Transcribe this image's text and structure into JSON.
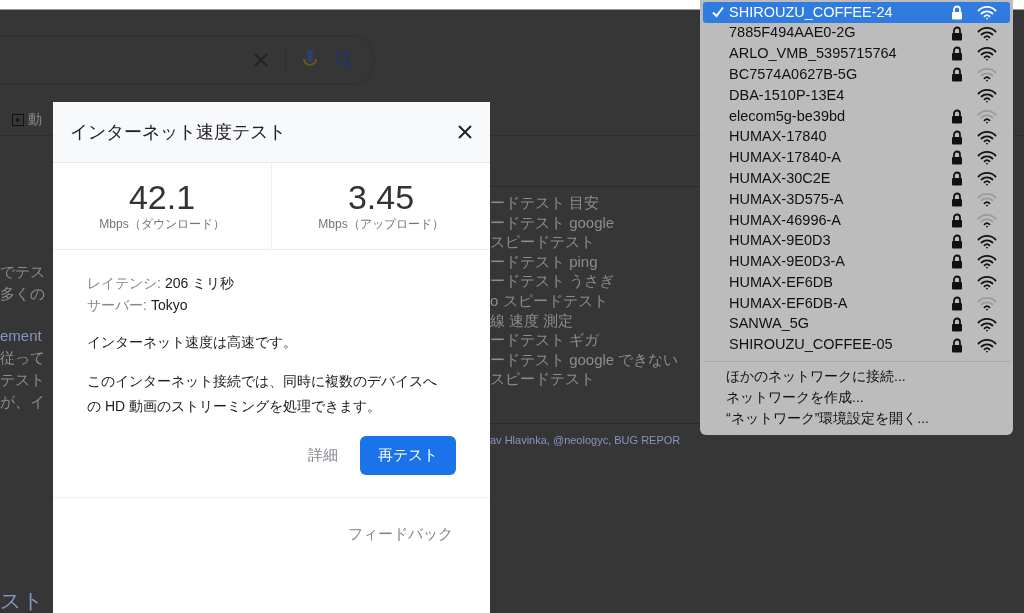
{
  "background_page": {
    "tab_fragment": "動",
    "left_fragments": [
      "でテス",
      "多くの",
      "ement",
      "従って",
      "テスト",
      "が、イ"
    ],
    "related_fragments": [
      "ードテスト 目安",
      "ードテスト google",
      "スピードテスト",
      "ードテスト ping",
      "ードテスト うさぎ",
      "o スピードテスト",
      "線 速度 測定",
      "ードテスト ギガ",
      "ードテスト google できない",
      "スピードテスト"
    ],
    "footer_fragment": "av Hlavinka, @neologyc, BUG REPOR",
    "bottom_heading_fragment": "スト"
  },
  "dialog": {
    "title": "インターネット速度テスト",
    "download": {
      "value": "42.1",
      "unit": "Mbps（ダウンロード）"
    },
    "upload": {
      "value": "3.45",
      "unit": "Mbps（アップロード）"
    },
    "latency": {
      "label": "レイテンシ:",
      "value": "206 ミリ秒"
    },
    "server": {
      "label": "サーバー:",
      "value": "Tokyo"
    },
    "verdict": "インターネット速度は高速です。",
    "description": "このインターネット接続では、同時に複数のデバイスへの HD 動画のストリーミングを処理できます。",
    "details_button": "詳細",
    "retest_button": "再テスト",
    "feedback_link": "フィードバック"
  },
  "wifi_menu": {
    "networks": [
      {
        "name": "SHIROUZU_COFFEE-24",
        "selected": true,
        "locked": true,
        "weak_signal": false
      },
      {
        "name": "7885F494AAE0-2G",
        "selected": false,
        "locked": true,
        "weak_signal": false
      },
      {
        "name": "ARLO_VMB_5395715764",
        "selected": false,
        "locked": true,
        "weak_signal": false
      },
      {
        "name": "BC7574A0627B-5G",
        "selected": false,
        "locked": true,
        "weak_signal": true
      },
      {
        "name": "DBA-1510P-13E4",
        "selected": false,
        "locked": false,
        "weak_signal": false
      },
      {
        "name": "elecom5g-be39bd",
        "selected": false,
        "locked": true,
        "weak_signal": true
      },
      {
        "name": "HUMAX-17840",
        "selected": false,
        "locked": true,
        "weak_signal": false
      },
      {
        "name": "HUMAX-17840-A",
        "selected": false,
        "locked": true,
        "weak_signal": false
      },
      {
        "name": "HUMAX-30C2E",
        "selected": false,
        "locked": true,
        "weak_signal": false
      },
      {
        "name": "HUMAX-3D575-A",
        "selected": false,
        "locked": true,
        "weak_signal": true
      },
      {
        "name": "HUMAX-46996-A",
        "selected": false,
        "locked": true,
        "weak_signal": true
      },
      {
        "name": "HUMAX-9E0D3",
        "selected": false,
        "locked": true,
        "weak_signal": false
      },
      {
        "name": "HUMAX-9E0D3-A",
        "selected": false,
        "locked": true,
        "weak_signal": false
      },
      {
        "name": "HUMAX-EF6DB",
        "selected": false,
        "locked": true,
        "weak_signal": false
      },
      {
        "name": "HUMAX-EF6DB-A",
        "selected": false,
        "locked": true,
        "weak_signal": true
      },
      {
        "name": "SANWA_5G",
        "selected": false,
        "locked": true,
        "weak_signal": false
      },
      {
        "name": "SHIROUZU_COFFEE-05",
        "selected": false,
        "locked": true,
        "weak_signal": false
      }
    ],
    "actions": [
      "ほかのネットワークに接続...",
      "ネットワークを作成...",
      "“ネットワーク”環境設定を開く..."
    ]
  }
}
